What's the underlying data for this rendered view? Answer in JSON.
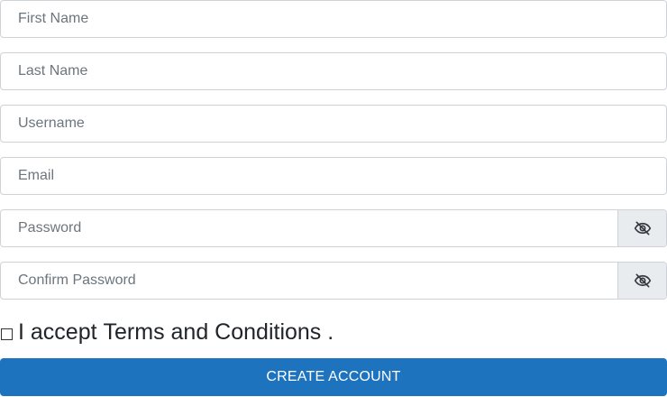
{
  "form": {
    "first_name": {
      "placeholder": "First Name",
      "value": ""
    },
    "last_name": {
      "placeholder": "Last Name",
      "value": ""
    },
    "username": {
      "placeholder": "Username",
      "value": ""
    },
    "email": {
      "placeholder": "Email",
      "value": ""
    },
    "password": {
      "placeholder": "Password",
      "value": "",
      "toggle_icon": "eye-slash-icon"
    },
    "confirm_password": {
      "placeholder": "Confirm Password",
      "value": "",
      "toggle_icon": "eye-slash-icon"
    },
    "terms": {
      "prefix": "I accept",
      "link_text": "Terms and Conditions",
      "suffix": ".",
      "checked": false
    },
    "submit_label": "CREATE ACCOUNT"
  },
  "colors": {
    "primary_button": "#1e73be",
    "input_border": "#cfd3d8",
    "addon_background": "#e9ecef"
  }
}
